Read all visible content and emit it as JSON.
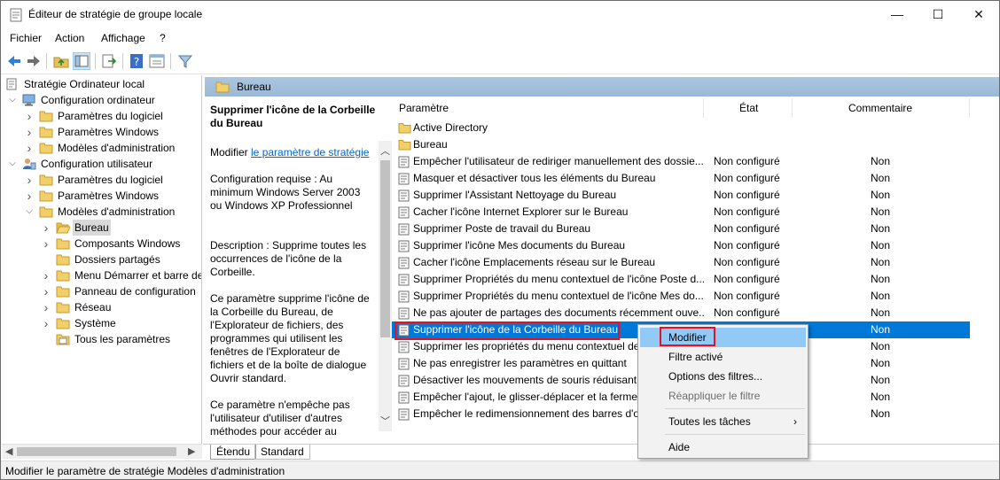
{
  "window": {
    "title": "Éditeur de stratégie de groupe locale",
    "controls": {
      "minimize": "—",
      "maximize": "☐",
      "close": "✕"
    }
  },
  "menu": [
    "Fichier",
    "Action",
    "Affichage",
    "?"
  ],
  "toolbar": {
    "icons": [
      "back-arrow-icon",
      "forward-arrow-icon",
      "up-folder-icon",
      "show-hide-tree-icon",
      "export-list-icon",
      "help-icon",
      "properties-icon",
      "filter-icon"
    ]
  },
  "tree": {
    "items": [
      {
        "label": "Stratégie Ordinateur local",
        "level": 0,
        "expander": "",
        "icon": "computer-policy-icon"
      },
      {
        "label": "Configuration ordinateur",
        "level": 1,
        "expander": "v",
        "icon": "computer-icon"
      },
      {
        "label": "Paramètres du logiciel",
        "level": 2,
        "expander": ">",
        "icon": "folder-icon"
      },
      {
        "label": "Paramètres Windows",
        "level": 2,
        "expander": ">",
        "icon": "folder-icon"
      },
      {
        "label": "Modèles d'administration",
        "level": 2,
        "expander": ">",
        "icon": "folder-icon"
      },
      {
        "label": "Configuration utilisateur",
        "level": 1,
        "expander": "v",
        "icon": "user-icon"
      },
      {
        "label": "Paramètres du logiciel",
        "level": 2,
        "expander": ">",
        "icon": "folder-icon"
      },
      {
        "label": "Paramètres Windows",
        "level": 2,
        "expander": ">",
        "icon": "folder-icon"
      },
      {
        "label": "Modèles d'administration",
        "level": 2,
        "expander": "v",
        "icon": "folder-icon"
      },
      {
        "label": "Bureau",
        "level": 3,
        "expander": ">",
        "icon": "folder-open-icon",
        "selected": true
      },
      {
        "label": "Composants Windows",
        "level": 3,
        "expander": ">",
        "icon": "folder-icon"
      },
      {
        "label": "Dossiers partagés",
        "level": 3,
        "expander": "",
        "icon": "folder-icon"
      },
      {
        "label": "Menu Démarrer et barre de",
        "level": 3,
        "expander": ">",
        "icon": "folder-icon"
      },
      {
        "label": "Panneau de configuration",
        "level": 3,
        "expander": ">",
        "icon": "folder-icon"
      },
      {
        "label": "Réseau",
        "level": 3,
        "expander": ">",
        "icon": "folder-icon"
      },
      {
        "label": "Système",
        "level": 3,
        "expander": ">",
        "icon": "folder-icon"
      },
      {
        "label": "Tous les paramètres",
        "level": 3,
        "expander": "",
        "icon": "all-settings-icon"
      }
    ]
  },
  "right_header": {
    "label": "Bureau"
  },
  "description": {
    "title": "Supprimer l'icône de la Corbeille du Bureau",
    "modify_prefix": "Modifier ",
    "modify_link": "le paramètre de stratégie",
    "requirements": "Configuration requise : Au minimum Windows Server 2003 ou Windows XP Professionnel",
    "description": "Description : Supprime toutes les occurrences de l'icône de la Corbeille.",
    "body1": "Ce paramètre supprime l'icône de la Corbeille du Bureau, de l'Explorateur de fichiers, des programmes qui utilisent les fenêtres de l'Explorateur de fichiers et de la boîte de dialogue Ouvrir standard.",
    "body2": "Ce paramètre n'empêche pas l'utilisateur d'utiliser d'autres méthodes pour accéder au"
  },
  "columns": {
    "name": "Paramètre",
    "state": "État",
    "comment": "Commentaire"
  },
  "rows": [
    {
      "type": "folder",
      "name": "Active Directory",
      "state": "",
      "comment": ""
    },
    {
      "type": "folder",
      "name": "Bureau",
      "state": "",
      "comment": ""
    },
    {
      "type": "setting",
      "name": "Empêcher l'utilisateur de rediriger manuellement des dossie...",
      "state": "Non configuré",
      "comment": "Non"
    },
    {
      "type": "setting",
      "name": "Masquer et désactiver tous les éléments du Bureau",
      "state": "Non configuré",
      "comment": "Non"
    },
    {
      "type": "setting",
      "name": "Supprimer l'Assistant Nettoyage du Bureau",
      "state": "Non configuré",
      "comment": "Non"
    },
    {
      "type": "setting",
      "name": "Cacher l'icône Internet Explorer sur le Bureau",
      "state": "Non configuré",
      "comment": "Non"
    },
    {
      "type": "setting",
      "name": "Supprimer Poste de travail du Bureau",
      "state": "Non configuré",
      "comment": "Non"
    },
    {
      "type": "setting",
      "name": "Supprimer l'icône Mes documents du Bureau",
      "state": "Non configuré",
      "comment": "Non"
    },
    {
      "type": "setting",
      "name": "Cacher l'icône Emplacements réseau sur le Bureau",
      "state": "Non configuré",
      "comment": "Non"
    },
    {
      "type": "setting",
      "name": "Supprimer Propriétés du menu contextuel de l'icône Poste d...",
      "state": "Non configuré",
      "comment": "Non"
    },
    {
      "type": "setting",
      "name": "Supprimer Propriétés du menu contextuel de l'icône Mes do...",
      "state": "Non configuré",
      "comment": "Non"
    },
    {
      "type": "setting",
      "name": "Ne pas ajouter de partages des documents récemment ouve...",
      "state": "Non configuré",
      "comment": "Non"
    },
    {
      "type": "setting",
      "name": "Supprimer l'icône de la Corbeille du Bureau",
      "state": "",
      "comment": "Non",
      "selected": true
    },
    {
      "type": "setting",
      "name": "Supprimer les propriétés du menu contextuel de",
      "state": "",
      "comment": "Non"
    },
    {
      "type": "setting",
      "name": "Ne pas enregistrer les paramètres en quittant",
      "state": "",
      "comment": "Non"
    },
    {
      "type": "setting",
      "name": "Désactiver les mouvements de souris réduisant l",
      "state": "",
      "comment": "Non"
    },
    {
      "type": "setting",
      "name": "Empêcher l'ajout, le glisser-déplacer et la fermet",
      "state": "",
      "comment": "Non"
    },
    {
      "type": "setting",
      "name": "Empêcher le redimensionnement des barres d'o",
      "state": "",
      "comment": "Non"
    }
  ],
  "context_menu": [
    {
      "label": "Modifier",
      "highlighted": true
    },
    {
      "label": "Filtre activé"
    },
    {
      "label": "Options des filtres..."
    },
    {
      "label": "Réappliquer le filtre",
      "disabled": true
    },
    {
      "separator": true
    },
    {
      "label": "Toutes les tâches",
      "submenu": "›"
    },
    {
      "separator": true
    },
    {
      "label": "Aide"
    }
  ],
  "tabs": [
    "Étendu",
    "Standard"
  ],
  "status": "Modifier le paramètre de stratégie Modèles d'administration",
  "colors": {
    "selection": "#0078d7",
    "header": "#9bb8d6",
    "highlight_box": "#e81123",
    "menu_hover": "#91c9f7"
  }
}
